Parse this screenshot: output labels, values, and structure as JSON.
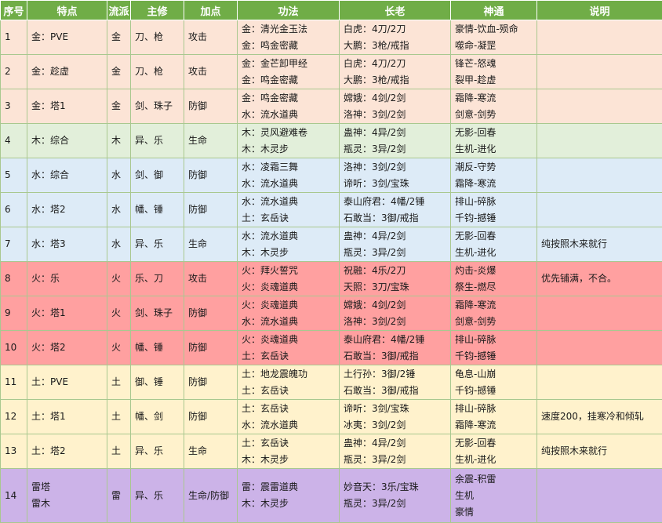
{
  "headers": [
    "序号",
    "特点",
    "流派",
    "主修",
    "加点",
    "功法",
    "长老",
    "神通",
    "说明"
  ],
  "rows": [
    {
      "no": "1",
      "feature": "金：PVE",
      "school": "金",
      "main": "刀、枪",
      "stat": "攻击",
      "gongfa": [
        "金：清光金玉法",
        "金：鸣金密藏"
      ],
      "elders": [
        "白虎：4刀/2刀",
        "大鹏：3枪/戒指"
      ],
      "shentong": [
        "豪情-饮血-殒命",
        "噬命-凝罡"
      ],
      "note": "",
      "bg": "#fce4d6"
    },
    {
      "no": "2",
      "feature": "金：趁虚",
      "school": "金",
      "main": "刀、枪",
      "stat": "攻击",
      "gongfa": [
        "金：金芒卸甲经",
        "金：鸣金密藏"
      ],
      "elders": [
        "白虎：4刀/2刀",
        "大鹏：3枪/戒指"
      ],
      "shentong": [
        "锋芒-怒魂",
        "裂甲-趁虚"
      ],
      "note": "",
      "bg": "#fce4d6"
    },
    {
      "no": "3",
      "feature": "金：塔1",
      "school": "金",
      "main": "剑、珠子",
      "stat": "防御",
      "gongfa": [
        "金：鸣金密藏",
        "水：流水道典"
      ],
      "elders": [
        "嫦娥：4剑/2剑",
        "洛神：3剑/2剑"
      ],
      "shentong": [
        "霜降-寒流",
        "剑意-剑势"
      ],
      "note": "",
      "bg": "#fce4d6"
    },
    {
      "no": "4",
      "feature": "木：综合",
      "school": "木",
      "main": "异、乐",
      "stat": "生命",
      "gongfa": [
        "木：灵风避难卷",
        "木：木灵步"
      ],
      "elders": [
        "蛊神：4异/2剑",
        "瓶灵：3异/2剑"
      ],
      "shentong": [
        "无影-回春",
        "生机-进化"
      ],
      "note": "",
      "bg": "#e2efda"
    },
    {
      "no": "5",
      "feature": "水：综合",
      "school": "水",
      "main": "剑、御",
      "stat": "防御",
      "gongfa": [
        "水：凌霜三舞",
        "水：流水道典"
      ],
      "elders": [
        "洛神：3剑/2剑",
        "谛听：3剑/宝珠"
      ],
      "shentong": [
        "潮反-守势",
        "霜降-寒流"
      ],
      "note": "",
      "bg": "#ddebf7"
    },
    {
      "no": "6",
      "feature": "水：塔2",
      "school": "水",
      "main": "幡、锤",
      "stat": "防御",
      "gongfa": [
        "水：流水道典",
        "土：玄岳诀"
      ],
      "elders": [
        "泰山府君：4幡/2锤",
        "石敢当：3御/戒指"
      ],
      "shentong": [
        "排山-碎脉",
        "千钧-撼锤"
      ],
      "note": "",
      "bg": "#ddebf7"
    },
    {
      "no": "7",
      "feature": "水：塔3",
      "school": "水",
      "main": "异、乐",
      "stat": "生命",
      "gongfa": [
        "水：流水道典",
        "木：木灵步"
      ],
      "elders": [
        "蛊神：4异/2剑",
        "瓶灵：3异/2剑"
      ],
      "shentong": [
        "无影-回春",
        "生机-进化"
      ],
      "note": "纯按照木来就行",
      "bg": "#ddebf7"
    },
    {
      "no": "8",
      "feature": "火：乐",
      "school": "火",
      "main": "乐、刀",
      "stat": "攻击",
      "gongfa": [
        "火：拜火誓咒",
        "火：炎魂道典"
      ],
      "elders": [
        "祝融：4乐/2刀",
        "天照：3刀/宝珠"
      ],
      "shentong": [
        "灼击-炎爆",
        "祭生-燃尽"
      ],
      "note": "优先铺满，不合。",
      "bg": "#ffa0a0"
    },
    {
      "no": "9",
      "feature": "火：塔1",
      "school": "火",
      "main": "剑、珠子",
      "stat": "防御",
      "gongfa": [
        "火：炎魂道典",
        "水：流水道典"
      ],
      "elders": [
        "嫦娥：4剑/2剑",
        "洛神：3剑/2剑"
      ],
      "shentong": [
        "霜降-寒流",
        "剑意-剑势"
      ],
      "note": "",
      "bg": "#ffa0a0"
    },
    {
      "no": "10",
      "feature": "火：塔2",
      "school": "火",
      "main": "幡、锤",
      "stat": "防御",
      "gongfa": [
        "火：炎魂道典",
        "土：玄岳诀"
      ],
      "elders": [
        "泰山府君：4幡/2锤",
        "石敢当：3御/戒指"
      ],
      "shentong": [
        "排山-碎脉",
        "千钧-撼锤"
      ],
      "note": "",
      "bg": "#ffa0a0"
    },
    {
      "no": "11",
      "feature": "土：PVE",
      "school": "土",
      "main": "御、锤",
      "stat": "防御",
      "gongfa": [
        "土：地龙震魄功",
        "土：玄岳诀"
      ],
      "elders": [
        "土行孙：3御/2锤",
        "石敢当：3御/戒指"
      ],
      "shentong": [
        "龟息-山崩",
        "千钧-撼锤"
      ],
      "note": "",
      "bg": "#fff2cc"
    },
    {
      "no": "12",
      "feature": "土：塔1",
      "school": "土",
      "main": "幡、剑",
      "stat": "防御",
      "gongfa": [
        "土：玄岳诀",
        "水：流水道典"
      ],
      "elders": [
        "谛听：3剑/宝珠",
        "冰夷：3剑/2剑"
      ],
      "shentong": [
        "排山-碎脉",
        "霜降-寒流"
      ],
      "note": "速度200，挂寒冷和倾轧",
      "bg": "#fff2cc"
    },
    {
      "no": "13",
      "feature": "土：塔2",
      "school": "土",
      "main": "异、乐",
      "stat": "生命",
      "gongfa": [
        "土：玄岳诀",
        "木：木灵步"
      ],
      "elders": [
        "蛊神：4异/2剑",
        "瓶灵：3异/2剑"
      ],
      "shentong": [
        "无影-回春",
        "生机-进化"
      ],
      "note": "纯按照木来就行",
      "bg": "#fff2cc"
    },
    {
      "no": "14",
      "feature": [
        "雷塔",
        "雷木"
      ],
      "school": "雷",
      "main": "异、乐",
      "stat": "生命/防御",
      "gongfa": [
        "雷：震雷道典",
        "木：木灵步"
      ],
      "elders": [
        "妙音天：3乐/宝珠",
        "瓶灵：3异/2剑"
      ],
      "shentong": [
        "余震-积雷",
        "生机",
        "豪情"
      ],
      "note": "",
      "bg": "#ccb3e8"
    }
  ]
}
